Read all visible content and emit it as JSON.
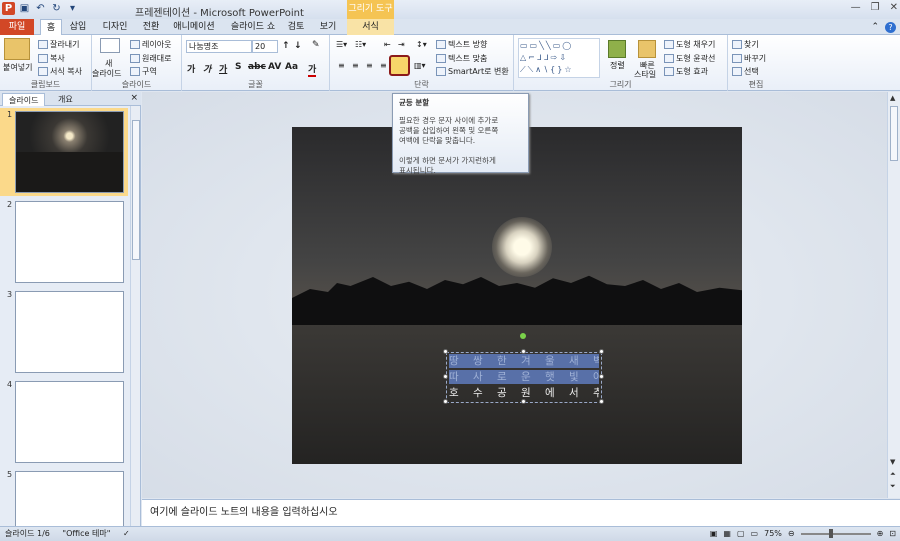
{
  "window": {
    "title": "프레젠테이션 - Microsoft PowerPoint",
    "context_group": "그리기 도구"
  },
  "qat": {
    "app_icon": "P"
  },
  "tabs": {
    "file": "파일",
    "home": "홈",
    "insert": "삽입",
    "design": "디자인",
    "transitions": "전환",
    "animations": "애니메이션",
    "slideshow": "슬라이드 쇼",
    "review": "검토",
    "view": "보기",
    "format": "서식"
  },
  "ribbon": {
    "clipboard": {
      "paste": "붙여넣기",
      "cut": "잘라내기",
      "copy": "복사",
      "format_painter": "서식 복사",
      "label": "클립보드"
    },
    "slides": {
      "new_slide_1": "새",
      "new_slide_2": "슬라이드",
      "layout": "레이아웃",
      "reset": "원래대로",
      "section": "구역",
      "label": "슬라이드"
    },
    "font": {
      "name": "나눔명조",
      "size": "20",
      "bold": "가",
      "italic": "가",
      "underline": "가",
      "shadow": "S",
      "strike": "abc",
      "spacing": "AV",
      "case": "Aa",
      "color": "가",
      "label": "글꼴"
    },
    "paragraph": {
      "text_dir": "텍스트 방향",
      "align_text": "텍스트 맞춤",
      "smartart": "SmartArt로 변환",
      "label": "단락"
    },
    "drawing": {
      "arrange": "정렬",
      "quick_styles_1": "빠른",
      "quick_styles_2": "스타일",
      "shape_fill": "도형 채우기",
      "shape_outline": "도형 윤곽선",
      "shape_effects": "도형 효과",
      "label": "그리기"
    },
    "editing": {
      "find": "찾기",
      "replace": "바꾸기",
      "select": "선택",
      "label": "편집"
    }
  },
  "tooltip": {
    "title": "균등 분할",
    "line1": "필요한 경우 문자 사이에 추가로",
    "line2": "공백을 삽입하여 왼쪽 및 오른쪽",
    "line3": "여백에 단락을 맞춥니다.",
    "line4": "이렇게 하면 문서가 가지런하게",
    "line5": "표시됩니다."
  },
  "pane": {
    "tab_slides": "슬라이드",
    "tab_outline": "개요",
    "close": "×",
    "numbers": [
      "1",
      "2",
      "3",
      "4",
      "5"
    ]
  },
  "slide": {
    "line1": "땅 쌍 한 겨 울 새 벽",
    "line2": "따 사 로 운 햇 빛 아 래",
    "line3": "호 수 공 원 에 서 추 억 을"
  },
  "notes": {
    "placeholder": "여기에 슬라이드 노트의 내용을 입력하십시오"
  },
  "status": {
    "slide": "슬라이드 1/6",
    "theme": "\"Office 테마\"",
    "zoom": "75%"
  }
}
